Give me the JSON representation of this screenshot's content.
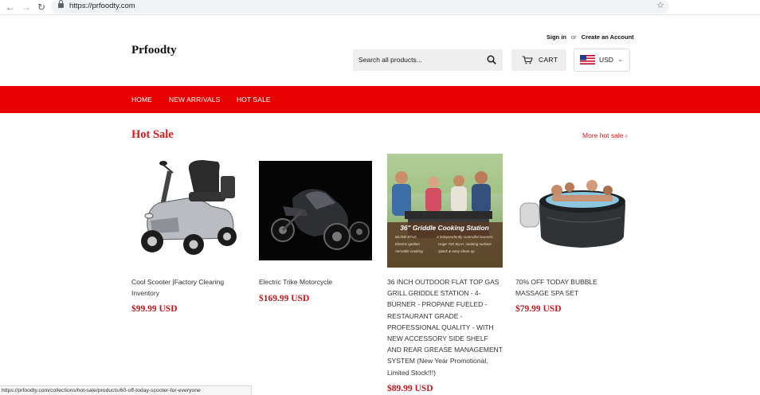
{
  "browser": {
    "url": "https://prfoodty.com"
  },
  "header": {
    "logo": "Prfoodty",
    "sign_in": "Sign in",
    "or": "or",
    "create_account": "Create an Account",
    "search_placeholder": "Search all products...",
    "cart_label": "CART",
    "currency": "USD"
  },
  "nav": {
    "items": [
      "HOME",
      "NEW ARRIVALS",
      "HOT SALE"
    ]
  },
  "section": {
    "title": "Hot Sale",
    "more_link": "More hot sale ›"
  },
  "products": [
    {
      "name": "Cool Scooter |Factory Clearing Inventory",
      "price": "$99.99 USD",
      "image": "mobility-scooter"
    },
    {
      "name": "Electric Trike Motorcycle",
      "price": "$169.99 USD",
      "image": "electric-trike"
    },
    {
      "name": "36 INCH OUTDOOR FLAT TOP GAS GRILL GRIDDLE STATION - 4-BURNER - PROPANE FUELED - RESTAURANT GRADE - PROFESSIONAL QUALITY - WITH NEW ACCESSORY SIDE SHELF AND REAR GREASE MANAGEMENT SYSTEM (New Year Promotional, Limited Stock!!!)",
      "price": "$89.99 USD",
      "image": "griddle-station",
      "image_text": {
        "headline": "36\" Griddle Cooking Station",
        "features": [
          "60,000 BTUs",
          "4 independently controlled burners",
          "Electric ignition",
          "Huge 720 Sq.In. cooking surface",
          "Versatile cooking",
          "Quick & easy clean up"
        ]
      }
    },
    {
      "name": "70% OFF TODAY BUBBLE MASSAGE SPA SET",
      "price": "$79.99 USD",
      "image": "inflatable-hot-tub"
    }
  ],
  "status_bar": "https://prfoodty.com/collections/hot-sale/products/60-off-today-scooter-for-everyone",
  "colors": {
    "accent": "#e80000",
    "price": "#c8161d"
  }
}
